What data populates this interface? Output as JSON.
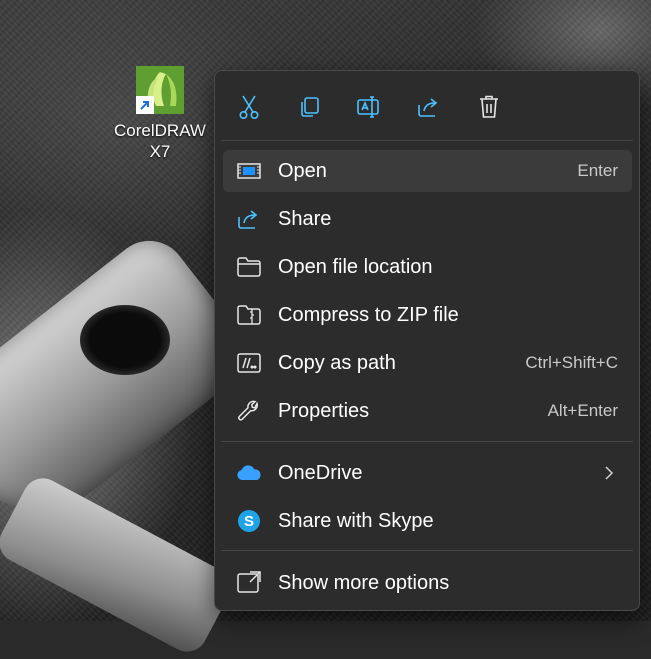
{
  "desktop": {
    "icon_label": "CorelDRAW X7"
  },
  "toolbar": {
    "cut": "cut-icon",
    "copy": "copy-icon",
    "rename": "rename-icon",
    "share": "share-icon",
    "delete": "delete-icon"
  },
  "menu": {
    "items": [
      {
        "label": "Open",
        "shortcut": "Enter",
        "icon": "open-app-icon"
      },
      {
        "label": "Share",
        "icon": "share-icon"
      },
      {
        "label": "Open file location",
        "icon": "folder-icon"
      },
      {
        "label": "Compress to ZIP file",
        "icon": "zip-icon"
      },
      {
        "label": "Copy as path",
        "shortcut": "Ctrl+Shift+C",
        "icon": "copy-path-icon"
      },
      {
        "label": "Properties",
        "shortcut": "Alt+Enter",
        "icon": "wrench-icon"
      },
      {
        "label": "OneDrive",
        "icon": "onedrive-icon"
      },
      {
        "label": "Share with Skype",
        "icon": "skype-icon"
      },
      {
        "label": "Show more options",
        "icon": "show-more-icon"
      }
    ]
  },
  "colors": {
    "accent": "#4cc2ff",
    "menu_bg": "#2c2c2c",
    "hover_bg": "#3b3b3b",
    "coreldraw_green": "#6aa83a"
  }
}
